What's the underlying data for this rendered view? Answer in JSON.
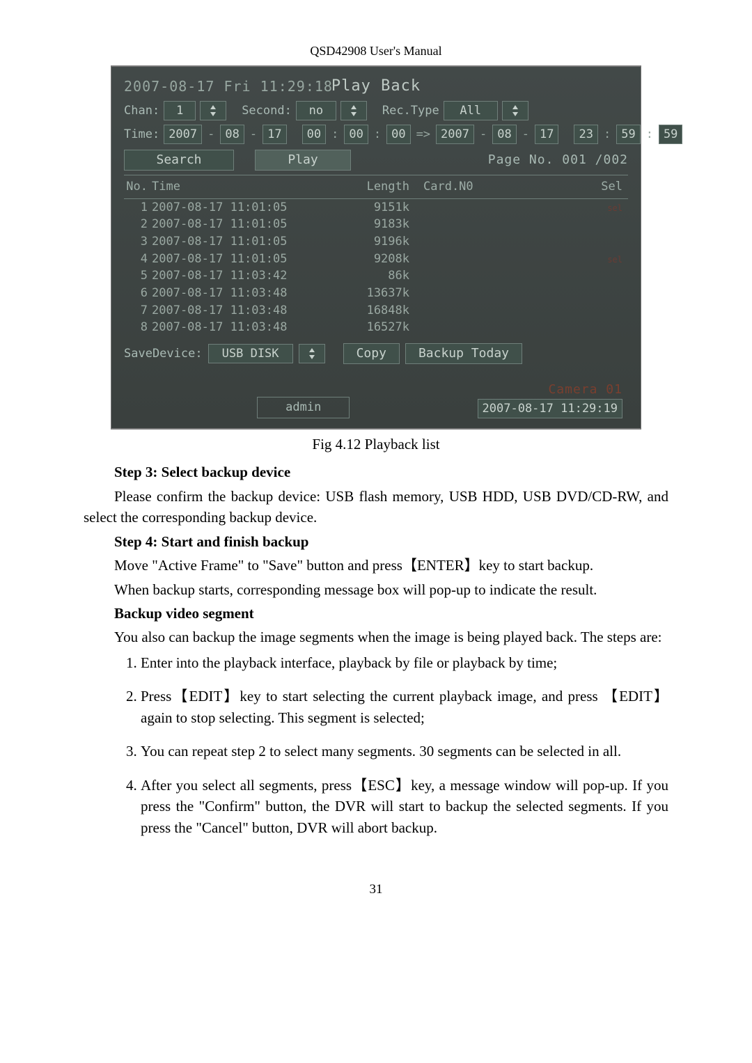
{
  "doc": {
    "header": "QSD42908 User's Manual",
    "page_number": "31"
  },
  "playback": {
    "timestamp": "2007-08-17 Fri 11:29:18",
    "title": "Play Back",
    "chan_label": "Chan:",
    "chan_value": "1",
    "second_label": "Second:",
    "second_value": "no",
    "rectype_label": "Rec.Type",
    "rectype_value": "All",
    "time_label": "Time:",
    "time_from": {
      "y": "2007",
      "mo": "08",
      "d": "17",
      "h": "00",
      "mi": "00",
      "s": "00"
    },
    "time_to": {
      "y": "2007",
      "mo": "08",
      "d": "17",
      "h": "23",
      "mi": "59",
      "s": "59"
    },
    "arrow": "=>",
    "search_btn": "Search",
    "play_btn": "Play",
    "pageno_label": "Page No.",
    "pageno_value": "001 /002",
    "columns": {
      "no": "No.",
      "time": "Time",
      "length": "Length",
      "card": "Card.N0",
      "sel": "Sel"
    },
    "rows": [
      {
        "no": "1",
        "time": "2007-08-17 11:01:05",
        "len": "9151k",
        "card": "",
        "sel": true
      },
      {
        "no": "2",
        "time": "2007-08-17 11:01:05",
        "len": "9183k",
        "card": "",
        "sel": false
      },
      {
        "no": "3",
        "time": "2007-08-17 11:01:05",
        "len": "9196k",
        "card": "",
        "sel": false
      },
      {
        "no": "4",
        "time": "2007-08-17 11:01:05",
        "len": "9208k",
        "card": "",
        "sel": true
      },
      {
        "no": "5",
        "time": "2007-08-17 11:03:42",
        "len": "86k",
        "card": "",
        "sel": false
      },
      {
        "no": "6",
        "time": "2007-08-17 11:03:48",
        "len": "13637k",
        "card": "",
        "sel": false
      },
      {
        "no": "7",
        "time": "2007-08-17 11:03:48",
        "len": "16848k",
        "card": "",
        "sel": false
      },
      {
        "no": "8",
        "time": "2007-08-17 11:03:48",
        "len": "16527k",
        "card": "",
        "sel": false
      }
    ],
    "save_label": "SaveDevice:",
    "save_value": "USB DISK",
    "copy_btn": "Copy",
    "backup_btn": "Backup Today",
    "camera_label": "Camera 01",
    "admin_label": "admin",
    "footer_datetime": "2007-08-17 11:29:19"
  },
  "figure_caption": "Fig 4.12 Playback list",
  "body": {
    "step3_title": "Step 3: Select backup device",
    "step3_text": "Please confirm the backup device: USB flash memory, USB HDD, USB DVD/CD-RW, and select the corresponding backup device.",
    "step4_title": "Step 4: Start and finish backup",
    "step4_p1": "Move \"Active Frame\" to \"Save\" button and press【ENTER】key to start backup.",
    "step4_p2": "When backup starts, corresponding message box will pop-up to indicate the result.",
    "segment_title": "Backup video segment",
    "segment_intro": "You also can backup the image segments when the image is being played back. The steps are:",
    "seg1": "Enter into the playback interface, playback by file or playback by time;",
    "seg2": "Press【EDIT】key to start selecting the current playback image, and press 【EDIT】again to stop selecting. This segment is selected;",
    "seg3": "You can repeat step 2 to select many segments. 30 segments can be selected in all.",
    "seg4": "After you select all segments, press【ESC】key, a message window will pop-up. If you press the \"Confirm\" button, the DVR will start to backup the selected segments. If you press the \"Cancel\" button, DVR will abort backup."
  }
}
